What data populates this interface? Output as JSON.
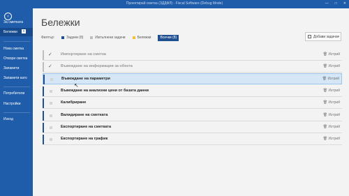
{
  "window": {
    "title": "Проектирай сметка (ЗДДФЛ) - Fiscal Software (Debug Mode)",
    "controls": [
      "—",
      "□",
      "✕"
    ]
  },
  "sidebar": {
    "items": [
      {
        "label": "За сметката",
        "badge": ""
      },
      {
        "label": "Бележки",
        "badge": "8"
      },
      {
        "label": "Нова сметка",
        "badge": ""
      },
      {
        "label": "Отвори сметка",
        "badge": ""
      },
      {
        "label": "Запамети",
        "badge": ""
      },
      {
        "label": "Запамети като",
        "badge": ""
      },
      {
        "label": "Потребители",
        "badge": ""
      },
      {
        "label": "Настройки",
        "badge": ""
      },
      {
        "label": "Изход",
        "badge": ""
      }
    ]
  },
  "main": {
    "title": "Бележки",
    "filters": {
      "label": "Филтър:",
      "chips": [
        {
          "label": "Задачи (8)",
          "color": "#1f4f8f"
        },
        {
          "label": "Изпълнени задачи",
          "color": "#bdbdbd"
        },
        {
          "label": "Бележки",
          "color": "#f0c040"
        },
        {
          "label": "Всички (8)",
          "color": "#1f4f8f"
        }
      ]
    },
    "add_button": "Добави задача",
    "tasks": [
      {
        "name": "Импортиране на сметка",
        "done": true,
        "delete": "Изтрий"
      },
      {
        "name": "Въвеждане на информация за обекта",
        "done": true,
        "delete": "Изтрий"
      },
      {
        "name": "Въвеждане на параметри",
        "done": false,
        "delete": "Изтрий"
      },
      {
        "name": "Въвеждане на анализни цени от базата данни",
        "done": false,
        "delete": "Изтрий"
      },
      {
        "name": "Калибриране",
        "done": false,
        "delete": "Изтрий"
      },
      {
        "name": "Валидиране на сметката",
        "done": false,
        "delete": "Изтрий"
      },
      {
        "name": "Експортиране на сметката",
        "done": false,
        "delete": "Изтрий"
      },
      {
        "name": "Експортиране на график",
        "done": false,
        "delete": "Изтрий"
      }
    ],
    "colors": {
      "accent": "#1f5ca9",
      "task_bar": "#1f4f8f",
      "done_bar": "#bdbdbd",
      "selected_row": "#d5e6f6"
    }
  }
}
